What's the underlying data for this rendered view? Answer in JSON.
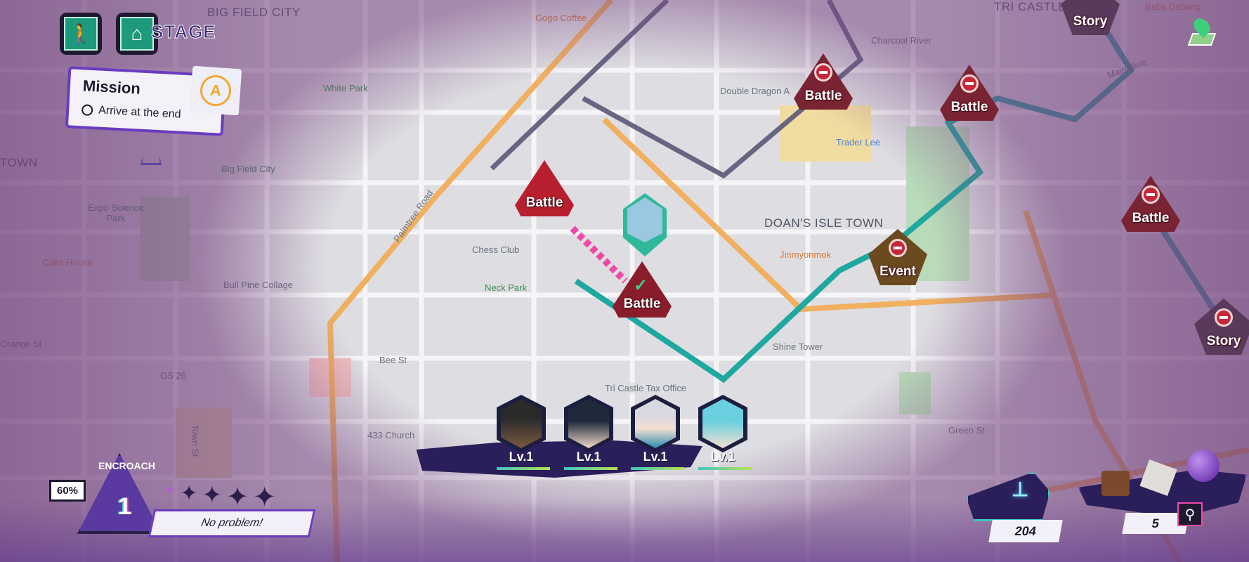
{
  "header": {
    "stage_label": "STAGE",
    "exit_icon": "exit-icon",
    "home_icon": "home-icon"
  },
  "mission": {
    "title": "Mission",
    "objective": "Arrive at the end",
    "rank": "A"
  },
  "map": {
    "labels": [
      "BIG FIELD CITY",
      "Gogo Coffee",
      "TRI CASTLE TO",
      "White Park",
      "Double Dragon A",
      "Charcoal River",
      "Trader Lee",
      "Big Field City",
      "Expo Science Park",
      "Cake House",
      "Chess Club",
      "Neck Park",
      "Bull Pine Collage",
      "DOAN'S ISLE TOWN",
      "Jinmyonmok",
      "Shine Tower",
      "GS 26",
      "433 Church",
      "Tri Castle Tax Office",
      "TOWN",
      "Palmtree Road",
      "Green St",
      "Bee St",
      "Orange St",
      "Town St",
      "Main Blue",
      "Baba Dabang"
    ]
  },
  "nodes": {
    "battle": "Battle",
    "event": "Event",
    "story": "Story"
  },
  "encroach": {
    "label": "ENCROACH",
    "level": "1",
    "percent": "60%",
    "message": "No problem!",
    "stars_filled": 1,
    "stars_total": 5
  },
  "team": [
    {
      "level": "Lv.1"
    },
    {
      "level": "Lv.1"
    },
    {
      "level": "Lv.1"
    },
    {
      "level": "Lv.1"
    }
  ],
  "resources": {
    "bolts": "204",
    "items": "5"
  },
  "colors": {
    "route": "#1fa8a0",
    "path": "#5a5878",
    "accent": "#6a3cc0",
    "battle": "#8a1d2c"
  }
}
